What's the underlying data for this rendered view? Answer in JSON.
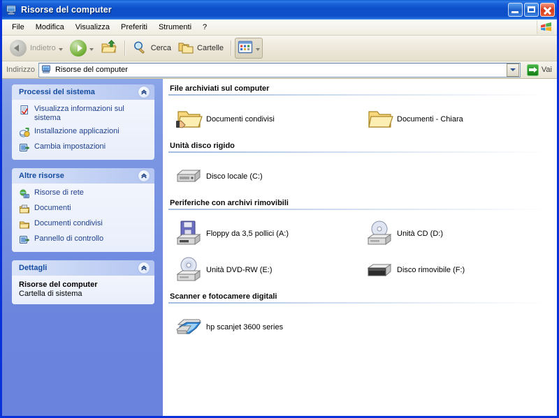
{
  "window": {
    "title": "Risorse del computer",
    "icon": "my-computer-icon",
    "buttons": {
      "minimize": "Riduci a icona",
      "maximize": "Ingrandisci",
      "close": "Chiudi"
    }
  },
  "menubar": {
    "items": [
      "File",
      "Modifica",
      "Visualizza",
      "Preferiti",
      "Strumenti",
      "?"
    ],
    "logo": "windows-flag-icon"
  },
  "toolbar": {
    "back": "Indietro",
    "forward": "",
    "up": "",
    "search": "Cerca",
    "folders": "Cartelle",
    "views": ""
  },
  "address": {
    "label": "Indirizzo",
    "value": "Risorse del computer",
    "go": "Vai"
  },
  "sidebar": {
    "panels": [
      {
        "title": "Processi del sistema",
        "links": [
          {
            "label": "Visualizza informazioni sul sistema",
            "icon": "system-info-icon"
          },
          {
            "label": "Installazione applicazioni",
            "icon": "add-remove-programs-icon"
          },
          {
            "label": "Cambia impostazioni",
            "icon": "change-settings-icon"
          }
        ]
      },
      {
        "title": "Altre risorse",
        "links": [
          {
            "label": "Risorse di rete",
            "icon": "network-icon"
          },
          {
            "label": "Documenti",
            "icon": "my-documents-icon"
          },
          {
            "label": "Documenti condivisi",
            "icon": "shared-documents-icon"
          },
          {
            "label": "Pannello di controllo",
            "icon": "control-panel-icon"
          }
        ]
      },
      {
        "title": "Dettagli",
        "details": {
          "name": "Risorse del computer",
          "type": "Cartella di sistema"
        }
      }
    ]
  },
  "content": {
    "groups": [
      {
        "header": "File archiviati sul computer",
        "items": [
          {
            "label": "Documenti condivisi",
            "icon": "shared-folder-icon"
          },
          {
            "label": "Documenti - Chiara",
            "icon": "folder-icon"
          }
        ]
      },
      {
        "header": "Unità disco rigido",
        "items": [
          {
            "label": "Disco locale (C:)",
            "icon": "hard-drive-icon"
          }
        ]
      },
      {
        "header": "Periferiche con archivi rimovibili",
        "items": [
          {
            "label": "Floppy da 3,5 pollici (A:)",
            "icon": "floppy-drive-icon"
          },
          {
            "label": "Unità CD (D:)",
            "icon": "cd-drive-icon"
          },
          {
            "label": "Unità DVD-RW (E:)",
            "icon": "dvd-rw-drive-icon"
          },
          {
            "label": "Disco rimovibile (F:)",
            "icon": "removable-disk-icon"
          }
        ]
      },
      {
        "header": "Scanner e fotocamere digitali",
        "items": [
          {
            "label": "hp scanjet 3600 series",
            "icon": "scanner-icon"
          }
        ]
      }
    ]
  },
  "colors": {
    "title_blue": "#0c4fc8",
    "window_border": "#0831d9",
    "sidebar_blue": "#7591e1",
    "panel_header_text": "#154ca0",
    "link_text": "#21428c",
    "go_green": "#127a12",
    "close_red": "#d63a1b"
  }
}
